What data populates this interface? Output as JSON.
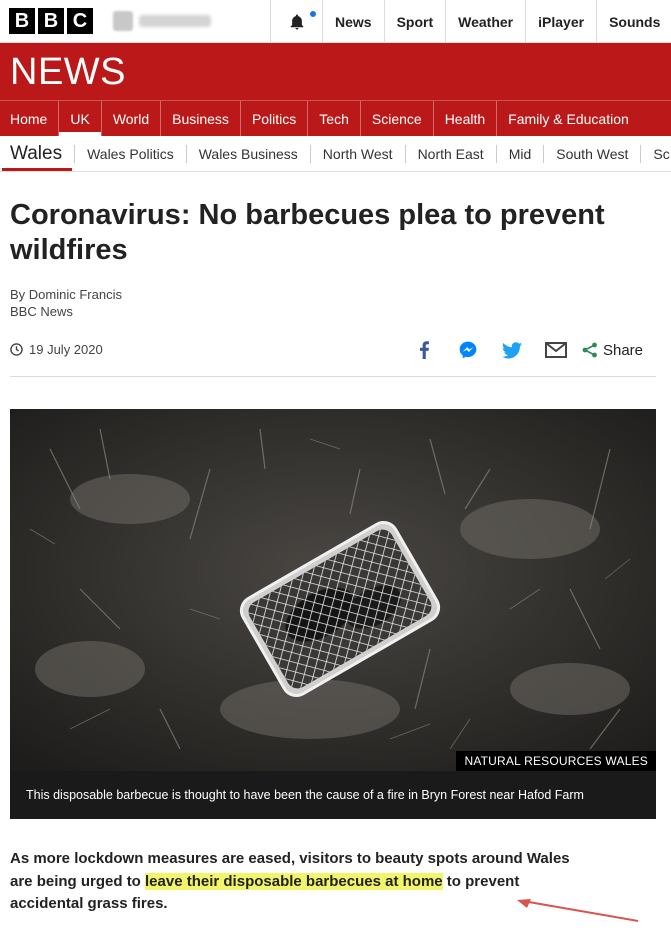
{
  "topbar": {
    "logo_letters": [
      "B",
      "B",
      "C"
    ],
    "nav": [
      "News",
      "Sport",
      "Weather",
      "iPlayer",
      "Sounds"
    ],
    "notification_icon": "bell-icon"
  },
  "header": {
    "title": "NEWS",
    "brand_color": "#bb1919"
  },
  "main_nav": [
    "Home",
    "UK",
    "World",
    "Business",
    "Politics",
    "Tech",
    "Science",
    "Health",
    "Family & Education"
  ],
  "main_nav_active": "UK",
  "sub_nav": {
    "region": "Wales",
    "items": [
      "Wales Politics",
      "Wales Business",
      "North West",
      "North East",
      "Mid",
      "South West",
      "Sc"
    ]
  },
  "article": {
    "headline": "Coronavirus: No barbecues plea to prevent wildfires",
    "byline_author": "By Dominic Francis",
    "byline_org": "BBC News",
    "date": "19 July 2020",
    "share_label": "Share",
    "share_icons": [
      "facebook-icon",
      "messenger-icon",
      "twitter-icon",
      "email-icon",
      "share-icon"
    ],
    "image_credit": "NATURAL RESOURCES WALES",
    "image_caption": "This disposable barbecue is thought to have been the cause of a fire in Bryn Forest near Hafod Farm",
    "intro_before": "As more lockdown measures are eased, visitors to beauty spots around Wales are being urged to ",
    "intro_highlight": "leave their disposable barbecues at home",
    "intro_after": " to prevent accidental grass fires.",
    "highlight_color": "#f2f56a",
    "annotation_arrow_color": "#d9534f"
  }
}
